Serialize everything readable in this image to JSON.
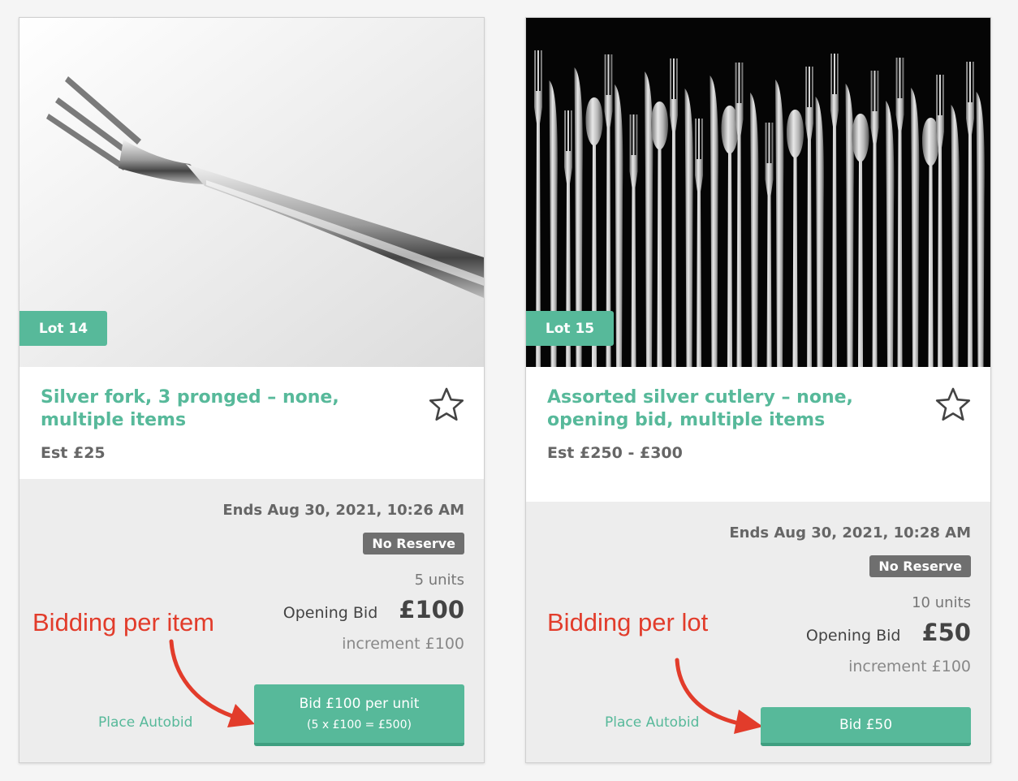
{
  "lots": [
    {
      "badge": "Lot 14",
      "title": "Silver fork, 3 pronged – none, multiple items",
      "estimate": "Est £25",
      "ends": "Ends Aug 30, 2021, 10:26 AM",
      "reserve_badge": "No Reserve",
      "units": "5 units",
      "opening_label": "Opening Bid",
      "opening_amount": "£100",
      "increment": "increment £100",
      "autobid_label": "Place Autobid",
      "bid_button_line1": "Bid £100 per unit",
      "bid_button_line2": "(5 x £100 = £500)",
      "annotation": "Bidding per item",
      "image_icon": "fork-photo"
    },
    {
      "badge": "Lot 15",
      "title": "Assorted silver cutlery – none, opening bid, multiple items",
      "estimate": "Est £250 - £300",
      "ends": "Ends Aug 30, 2021, 10:28 AM",
      "reserve_badge": "No Reserve",
      "units": "10 units",
      "opening_label": "Opening Bid",
      "opening_amount": "£50",
      "increment": "increment £100",
      "autobid_label": "Place Autobid",
      "bid_button_line1": "Bid £50",
      "annotation": "Bidding per lot",
      "image_icon": "cutlery-photo"
    }
  ],
  "colors": {
    "accent": "#57b99a",
    "annotation": "#e23c2b",
    "reserve_badge": "#6f6f6f"
  }
}
